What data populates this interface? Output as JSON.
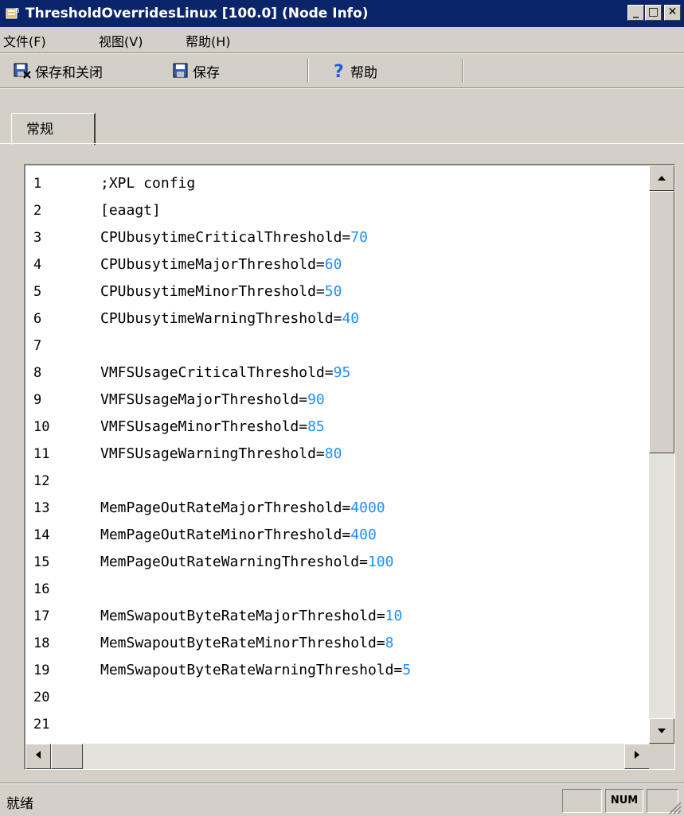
{
  "window": {
    "title": "ThresholdOverridesLinux [100.0] (Node Info)",
    "controls": {
      "minimize": "_",
      "maximize": "□",
      "close": "✕"
    }
  },
  "menu": [
    {
      "label": "文件(F)"
    },
    {
      "label": "视图(V)"
    },
    {
      "label": "帮助(H)"
    }
  ],
  "toolbar": {
    "save_close_label": "保存和关闭",
    "save_label": "保存",
    "help_label": "帮助"
  },
  "tabs": [
    {
      "label": "常规"
    }
  ],
  "editor": {
    "lines": [
      {
        "n": "1",
        "key": ";XPL config",
        "val": ""
      },
      {
        "n": "2",
        "key": "[eaagt]",
        "val": ""
      },
      {
        "n": "3",
        "key": "CPUbusytimeCriticalThreshold=",
        "val": "70"
      },
      {
        "n": "4",
        "key": "CPUbusytimeMajorThreshold=",
        "val": "60"
      },
      {
        "n": "5",
        "key": "CPUbusytimeMinorThreshold=",
        "val": "50"
      },
      {
        "n": "6",
        "key": "CPUbusytimeWarningThreshold=",
        "val": "40"
      },
      {
        "n": "7",
        "key": "",
        "val": ""
      },
      {
        "n": "8",
        "key": "VMFSUsageCriticalThreshold=",
        "val": "95"
      },
      {
        "n": "9",
        "key": "VMFSUsageMajorThreshold=",
        "val": "90"
      },
      {
        "n": "10",
        "key": "VMFSUsageMinorThreshold=",
        "val": "85"
      },
      {
        "n": "11",
        "key": "VMFSUsageWarningThreshold=",
        "val": "80"
      },
      {
        "n": "12",
        "key": "",
        "val": ""
      },
      {
        "n": "13",
        "key": "MemPageOutRateMajorThreshold=",
        "val": "4000"
      },
      {
        "n": "14",
        "key": "MemPageOutRateMinorThreshold=",
        "val": "400"
      },
      {
        "n": "15",
        "key": "MemPageOutRateWarningThreshold=",
        "val": "100"
      },
      {
        "n": "16",
        "key": "",
        "val": ""
      },
      {
        "n": "17",
        "key": "MemSwapoutByteRateMajorThreshold=",
        "val": "10"
      },
      {
        "n": "18",
        "key": "MemSwapoutByteRateMinorThreshold=",
        "val": "8"
      },
      {
        "n": "19",
        "key": "MemSwapoutByteRateWarningThreshold=",
        "val": "5"
      },
      {
        "n": "20",
        "key": "",
        "val": ""
      },
      {
        "n": "21",
        "key": "",
        "val": ""
      }
    ]
  },
  "status": {
    "text": "就绪",
    "num_indicator": "NUM"
  },
  "colors": {
    "title_bg": "#0a246a",
    "value_text": "#1e90ff"
  },
  "icons": {
    "title": "node-info-app-icon",
    "save_close": "save-close-icon",
    "save": "floppy-disk-icon",
    "help": "question-mark-icon"
  }
}
